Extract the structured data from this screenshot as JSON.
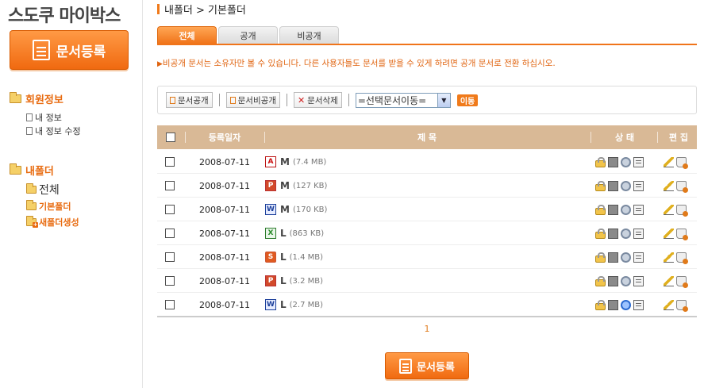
{
  "sidebar": {
    "logo": "스도쿠 마이박스",
    "register_button": "문서등록",
    "member_section": "회원정보",
    "member_items": [
      "내 정보",
      "내 정보 수정"
    ],
    "folder_section": "내폴더",
    "folder_items": {
      "all": "전체",
      "basic": "기본폴더",
      "new_folder": "새폴더생성"
    }
  },
  "breadcrumb": "내폴더 > 기본폴더",
  "tabs": [
    "전체",
    "공개",
    "비공개"
  ],
  "active_tab": "전체",
  "notice": "비공개 문서는 소유자만 볼 수 있습니다. 다른 사용자들도 문서를 받을 수 있게 하려면 공개 문서로 전환 하십시오.",
  "toolbar": {
    "make_public": "문서공개",
    "make_private": "문서비공개",
    "delete": "문서삭제",
    "move_select": "=선택문서이동=",
    "move_button": "이동"
  },
  "table": {
    "headers": [
      "등록일자",
      "제 목",
      "상 태",
      "편 집"
    ],
    "rows": [
      {
        "date": "2008-07-11",
        "type": "pdf",
        "glyph": "A",
        "name": "M",
        "size": "(7.4 MB)",
        "ie": "gray"
      },
      {
        "date": "2008-07-11",
        "type": "ppt",
        "glyph": "P",
        "name": "M",
        "size": "(127 KB)",
        "ie": "gray"
      },
      {
        "date": "2008-07-11",
        "type": "word",
        "glyph": "W",
        "name": "M",
        "size": "(170 KB)",
        "ie": "gray"
      },
      {
        "date": "2008-07-11",
        "type": "excel",
        "glyph": "X",
        "name": "L",
        "size": "(863 KB)",
        "ie": "gray"
      },
      {
        "date": "2008-07-11",
        "type": "show",
        "glyph": "S",
        "name": "L",
        "size": "(1.4 MB)",
        "ie": "gray"
      },
      {
        "date": "2008-07-11",
        "type": "ppt",
        "glyph": "P",
        "name": "L",
        "size": "(3.2 MB)",
        "ie": "gray"
      },
      {
        "date": "2008-07-11",
        "type": "word",
        "glyph": "W",
        "name": "L",
        "size": "(2.7 MB)",
        "ie": "blue"
      }
    ]
  },
  "pager": "1",
  "register_button_bottom": "문서등록",
  "colors": {
    "accent": "#f0741a",
    "header_bg": "#d9b996",
    "notice": "#e06410"
  }
}
